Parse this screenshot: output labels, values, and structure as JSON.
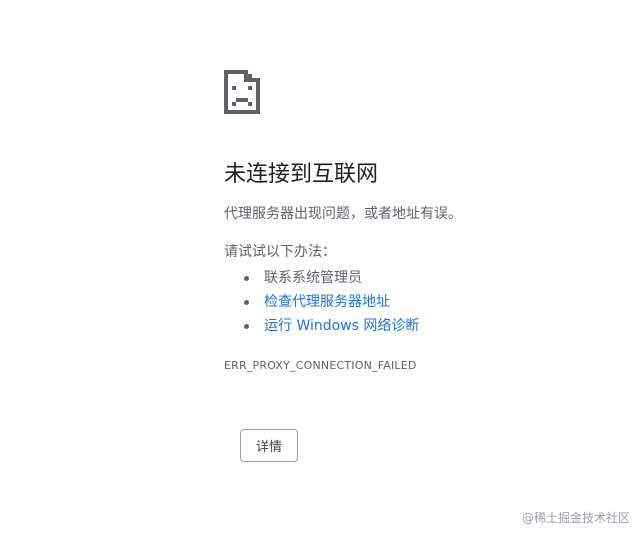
{
  "page": {
    "title": "未连接到互联网",
    "subtitle": "代理服务器出现问题，或者地址有误。",
    "try_label": "请试试以下办法：",
    "suggestions": [
      {
        "label": "联系系统管理员",
        "is_link": false
      },
      {
        "label": "检查代理服务器地址",
        "is_link": true
      },
      {
        "label": "运行 Windows 网络诊断",
        "is_link": true
      }
    ],
    "error_code": "ERR_PROXY_CONNECTION_FAILED",
    "details_button": "详情",
    "watermark": "@稀土掘金技术社区",
    "icon": "sad-page-icon"
  },
  "colors": {
    "link": "#1a73e8",
    "text": "#202124",
    "secondary": "#5f6368"
  }
}
